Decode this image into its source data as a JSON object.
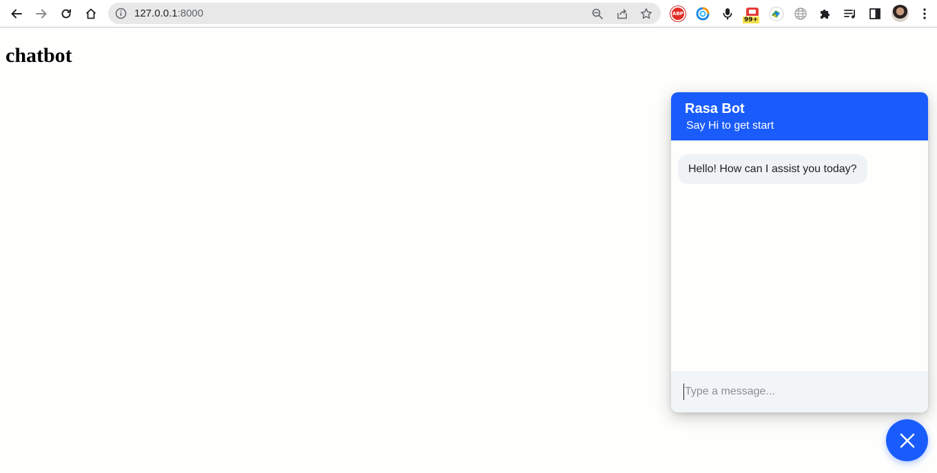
{
  "browser": {
    "url_host": "127.0.0.1",
    "url_port": ":8000",
    "extension_badge": "99+",
    "abp_label": "ABP"
  },
  "page": {
    "title": "chatbot"
  },
  "chat": {
    "header_title": "Rasa Bot",
    "header_subtitle": "Say Hi to get start",
    "messages": [
      {
        "sender": "bot",
        "text": "Hello! How can I assist you today?"
      }
    ],
    "input_placeholder": "Type a message...",
    "accent_color": "#1a5cfb"
  }
}
